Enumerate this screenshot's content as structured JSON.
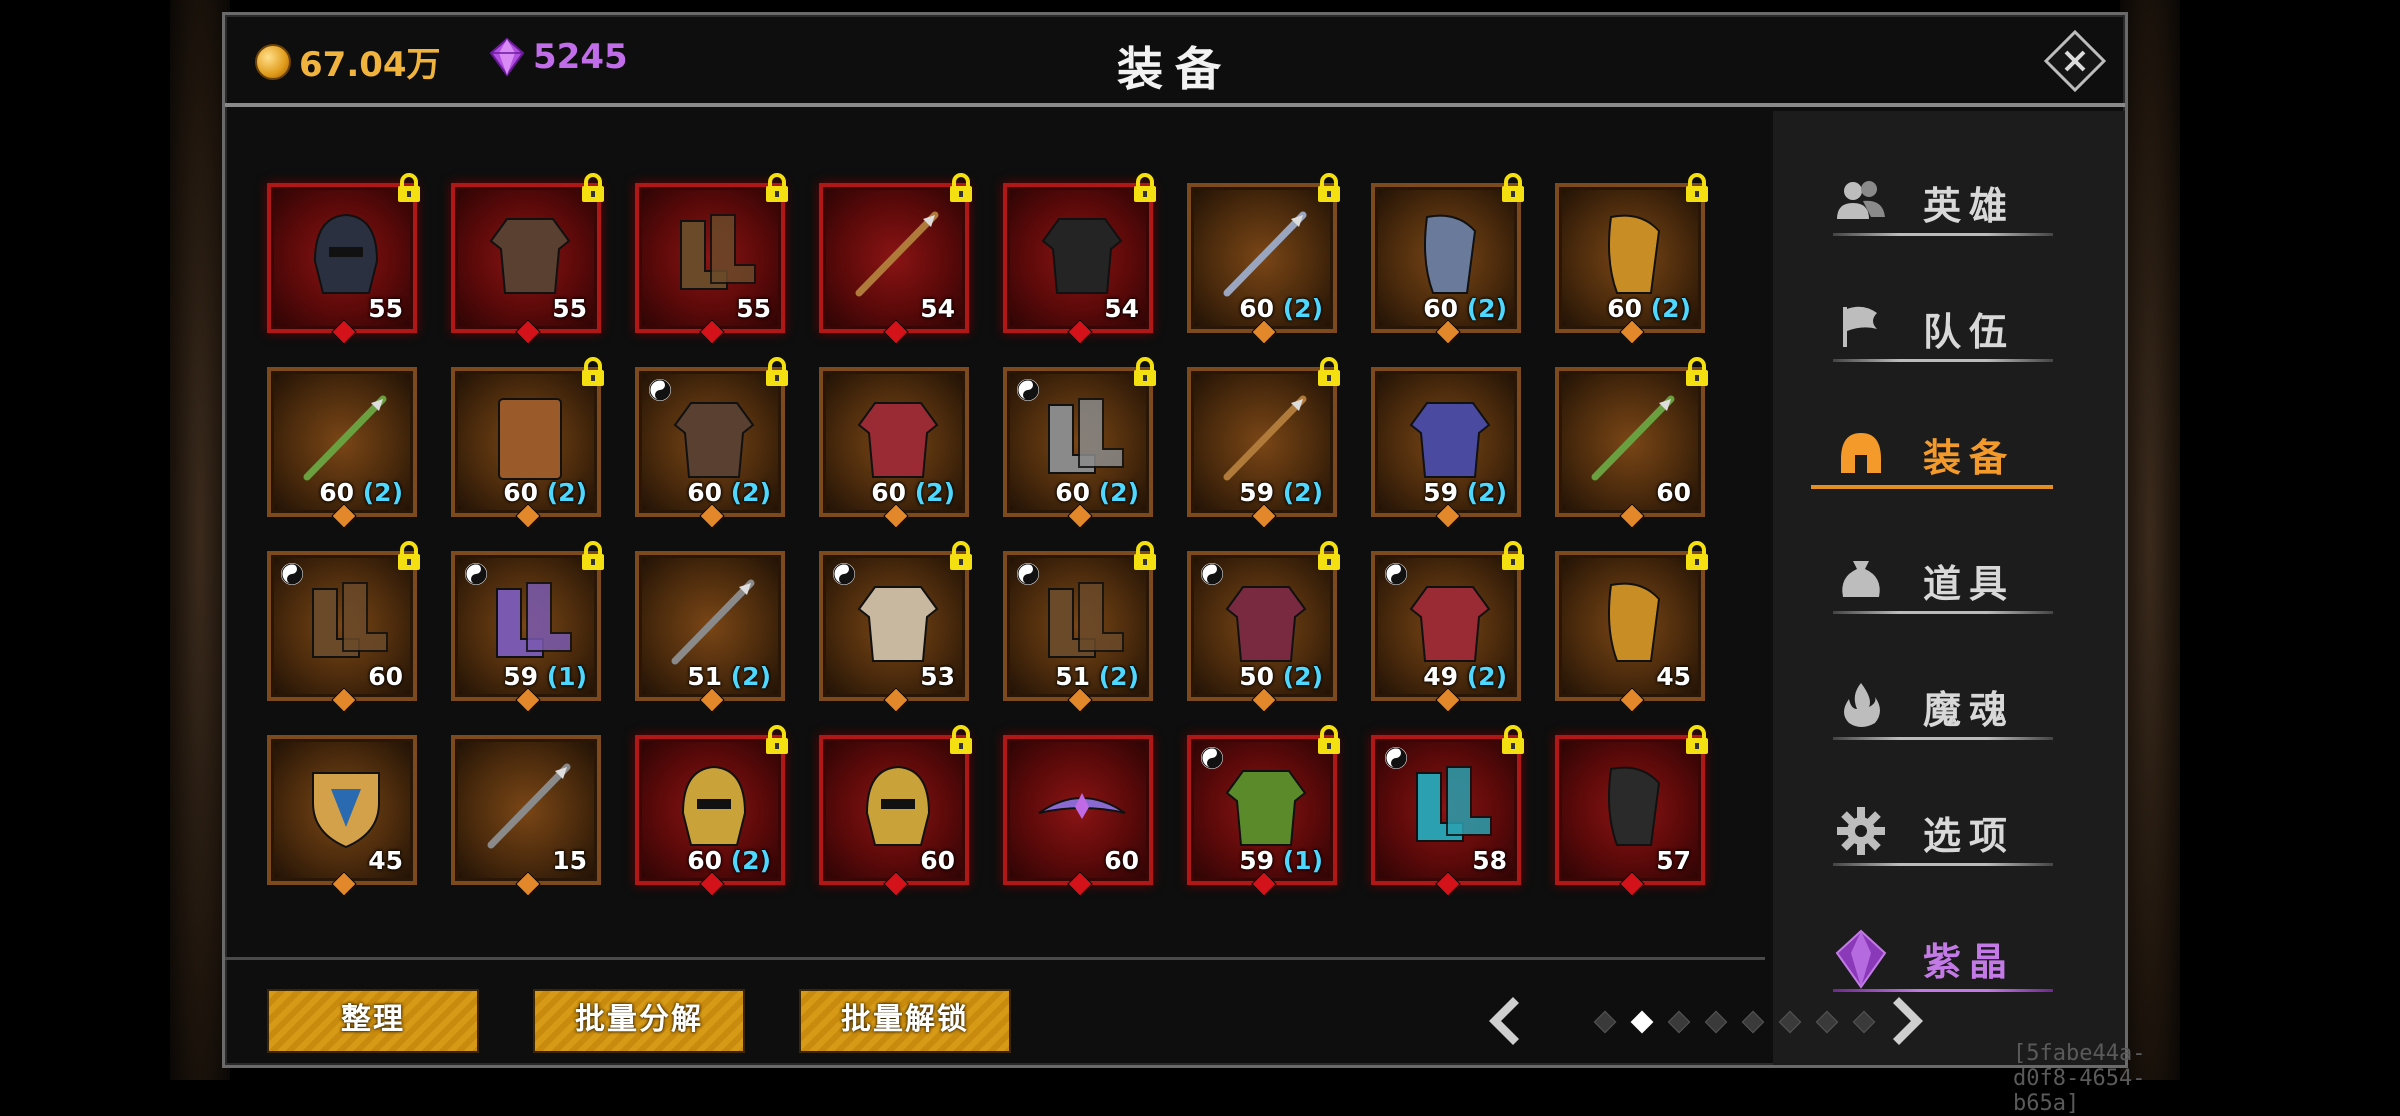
{
  "header": {
    "gold": "67.04万",
    "gems": "5245",
    "title": "装备"
  },
  "colors": {
    "gold": "#f0b33d",
    "gem": "#c16ce8",
    "active_tab": "#f39a2a",
    "bonus": "#4fd8ff",
    "red_rarity": "#b01818",
    "brown_rarity": "#7c4a1c"
  },
  "items": [
    {
      "icon": "dark-hood-helmet-icon",
      "level": "55",
      "bonus": "",
      "rarity": "red",
      "locked": true,
      "yin": false
    },
    {
      "icon": "leather-armor-icon",
      "level": "55",
      "bonus": "",
      "rarity": "red",
      "locked": true,
      "yin": false
    },
    {
      "icon": "leather-boots-icon",
      "level": "55",
      "bonus": "",
      "rarity": "red",
      "locked": true,
      "yin": false
    },
    {
      "icon": "arrow-icon",
      "level": "54",
      "bonus": "",
      "rarity": "red",
      "locked": true,
      "yin": false
    },
    {
      "icon": "black-armor-icon",
      "level": "54",
      "bonus": "",
      "rarity": "red",
      "locked": true,
      "yin": false
    },
    {
      "icon": "staff-icon",
      "level": "60",
      "bonus": "(2)",
      "rarity": "brown",
      "locked": true,
      "yin": false
    },
    {
      "icon": "steel-gauntlet-icon",
      "level": "60",
      "bonus": "(2)",
      "rarity": "brown",
      "locked": true,
      "yin": false
    },
    {
      "icon": "gold-gauntlet-icon",
      "level": "60",
      "bonus": "(2)",
      "rarity": "brown",
      "locked": true,
      "yin": false
    },
    {
      "icon": "green-arrow-icon",
      "level": "60",
      "bonus": "(2)",
      "rarity": "brown",
      "locked": false,
      "yin": false
    },
    {
      "icon": "book-icon",
      "level": "60",
      "bonus": "(2)",
      "rarity": "brown",
      "locked": true,
      "yin": false
    },
    {
      "icon": "red-armor-icon",
      "level": "60",
      "bonus": "(2)",
      "rarity": "brown",
      "locked": true,
      "yin": true
    },
    {
      "icon": "red-robe-icon",
      "level": "60",
      "bonus": "(2)",
      "rarity": "brown",
      "locked": false,
      "yin": false
    },
    {
      "icon": "grey-boots-icon",
      "level": "60",
      "bonus": "(2)",
      "rarity": "brown",
      "locked": true,
      "yin": true
    },
    {
      "icon": "golden-arrow-icon",
      "level": "59",
      "bonus": "(2)",
      "rarity": "brown",
      "locked": true,
      "yin": false
    },
    {
      "icon": "blue-robe-icon",
      "level": "59",
      "bonus": "(2)",
      "rarity": "brown",
      "locked": false,
      "yin": false
    },
    {
      "icon": "green-arrow-icon",
      "level": "60",
      "bonus": "",
      "rarity": "brown",
      "locked": true,
      "yin": false
    },
    {
      "icon": "red-boots-icon",
      "level": "60",
      "bonus": "",
      "rarity": "brown",
      "locked": true,
      "yin": true
    },
    {
      "icon": "purple-boots-icon",
      "level": "59",
      "bonus": "(1)",
      "rarity": "brown",
      "locked": true,
      "yin": true
    },
    {
      "icon": "spear-icon",
      "level": "51",
      "bonus": "(2)",
      "rarity": "brown",
      "locked": false,
      "yin": false
    },
    {
      "icon": "cloth-shirt-icon",
      "level": "53",
      "bonus": "",
      "rarity": "brown",
      "locked": true,
      "yin": true
    },
    {
      "icon": "brown-boots-icon",
      "level": "51",
      "bonus": "(2)",
      "rarity": "brown",
      "locked": true,
      "yin": true
    },
    {
      "icon": "maroon-robe-icon",
      "level": "50",
      "bonus": "(2)",
      "rarity": "brown",
      "locked": true,
      "yin": true
    },
    {
      "icon": "red-robe-icon",
      "level": "49",
      "bonus": "(2)",
      "rarity": "brown",
      "locked": true,
      "yin": true
    },
    {
      "icon": "gold-gauntlet-icon",
      "level": "45",
      "bonus": "",
      "rarity": "brown",
      "locked": true,
      "yin": false
    },
    {
      "icon": "shield-icon",
      "level": "45",
      "bonus": "",
      "rarity": "brown",
      "locked": false,
      "yin": false
    },
    {
      "icon": "spear-icon",
      "level": "15",
      "bonus": "",
      "rarity": "brown",
      "locked": false,
      "yin": false
    },
    {
      "icon": "gold-helmet-icon",
      "level": "60",
      "bonus": "(2)",
      "rarity": "red",
      "locked": true,
      "yin": false
    },
    {
      "icon": "gold-helmet-icon",
      "level": "60",
      "bonus": "",
      "rarity": "red",
      "locked": true,
      "yin": false
    },
    {
      "icon": "tiara-icon",
      "level": "60",
      "bonus": "",
      "rarity": "red",
      "locked": false,
      "yin": false
    },
    {
      "icon": "green-vest-icon",
      "level": "59",
      "bonus": "(1)",
      "rarity": "red",
      "locked": true,
      "yin": true
    },
    {
      "icon": "cyan-boots-icon",
      "level": "58",
      "bonus": "",
      "rarity": "red",
      "locked": true,
      "yin": true
    },
    {
      "icon": "black-claw-icon",
      "level": "57",
      "bonus": "",
      "rarity": "red",
      "locked": true,
      "yin": false
    }
  ],
  "sidebar": {
    "items": [
      {
        "label": "英雄",
        "icon": "heroes-icon",
        "active": false
      },
      {
        "label": "队伍",
        "icon": "flag-icon",
        "active": false
      },
      {
        "label": "装备",
        "icon": "helmet-icon",
        "active": true
      },
      {
        "label": "道具",
        "icon": "bag-icon",
        "active": false
      },
      {
        "label": "魔魂",
        "icon": "flame-icon",
        "active": false
      },
      {
        "label": "选项",
        "icon": "gear-icon",
        "active": false
      },
      {
        "label": "紫晶",
        "icon": "amethyst-icon",
        "active": false
      }
    ]
  },
  "buttons": {
    "sort": "整理",
    "batch_dismantle": "批量分解",
    "batch_unlock": "批量解锁"
  },
  "pager": {
    "page_count": 8,
    "current_page": 2
  },
  "footer": {
    "uid": "[5fabe44a-d0f8-4654-b65a]"
  }
}
